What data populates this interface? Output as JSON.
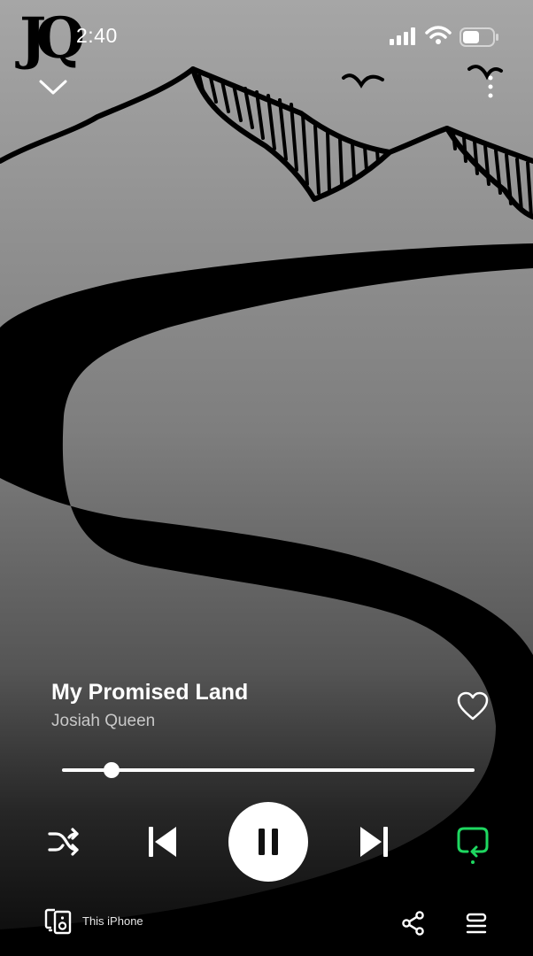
{
  "status_bar": {
    "time": "2:40",
    "battery_level": 0.55
  },
  "artwork": {
    "logo_text": "JQ"
  },
  "header": {
    "collapse_icon": "chevron-down-icon",
    "more_icon": "more-vertical-icon"
  },
  "track": {
    "title": "My Promised Land",
    "artist": "Josiah Queen",
    "liked": false
  },
  "playback": {
    "progress": 0.12,
    "state": "playing",
    "repeat_color": "#1ed760"
  },
  "bottom_bar": {
    "device_label": "This iPhone",
    "device_icon": "speaker-device-icon",
    "share_icon": "share-icon",
    "queue_icon": "queue-icon"
  }
}
